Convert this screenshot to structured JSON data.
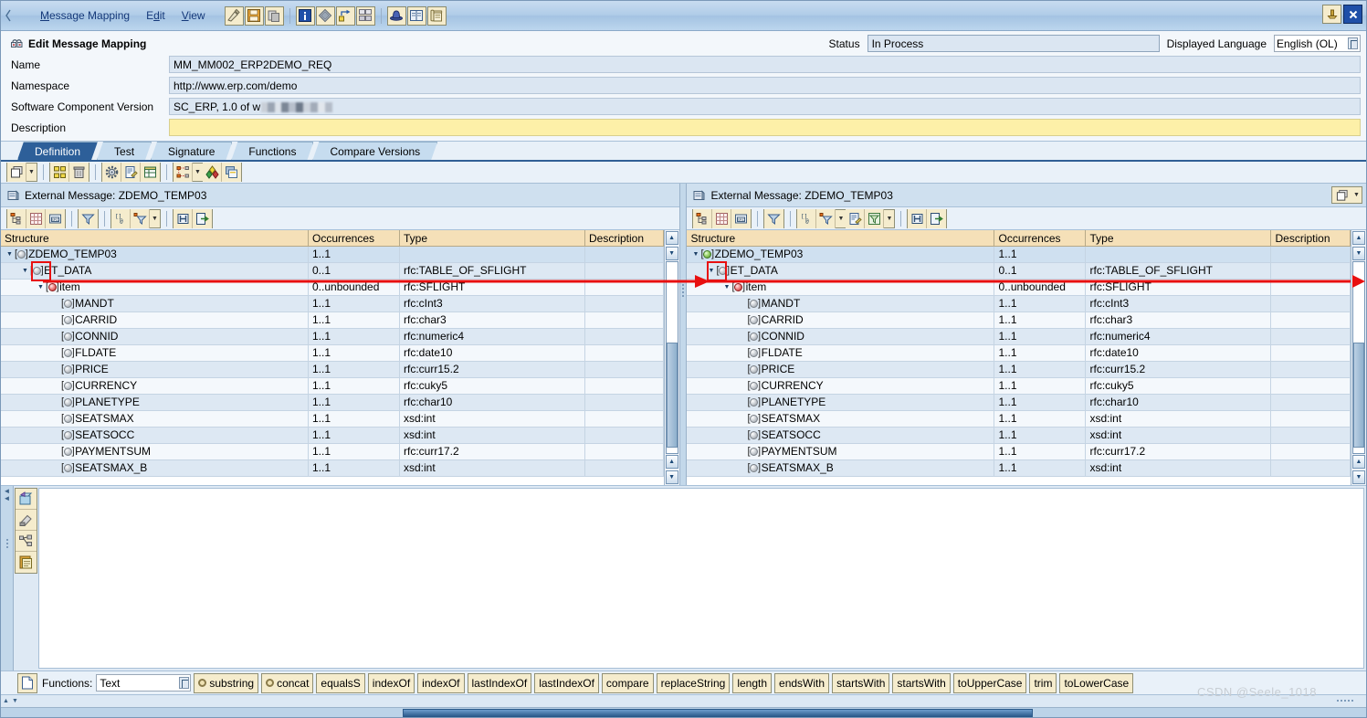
{
  "window": {
    "title": "Edit Message Mapping",
    "watermark": "CSDN @Seele_1018"
  },
  "menubar": {
    "items": [
      {
        "label": "Message Mapping",
        "accel": "M"
      },
      {
        "label": "Edit",
        "accel": "d"
      },
      {
        "label": "View",
        "accel": "V"
      }
    ],
    "tools": [
      {
        "name": "check-object-icon",
        "glyph": "✎"
      },
      {
        "name": "save-icon",
        "glyph": "💾"
      },
      {
        "name": "copy-object-icon",
        "glyph": "❐"
      },
      {
        "name": "info-icon",
        "glyph": "i"
      },
      {
        "name": "history-icon",
        "glyph": "◆"
      },
      {
        "name": "where-used-icon",
        "glyph": "⇆"
      },
      {
        "name": "dependencies-icon",
        "glyph": "⌗"
      },
      {
        "name": "release-icon",
        "glyph": "⛉"
      },
      {
        "name": "documentation-icon",
        "glyph": "📖"
      },
      {
        "name": "display-source-icon",
        "glyph": "📜"
      }
    ],
    "right_tools": [
      {
        "name": "pin-window-icon",
        "glyph": "⚓"
      },
      {
        "name": "close-window-icon",
        "glyph": "✖"
      }
    ]
  },
  "header": {
    "fields": [
      {
        "label": "Name",
        "value": "MM_MM002_ERP2DEMO_REQ",
        "style": "normal"
      },
      {
        "label": "Namespace",
        "value": "http://www.erp.com/demo",
        "style": "normal"
      },
      {
        "label": "Software Component Version",
        "value": "SC_ERP, 1.0 of w",
        "style": "redacted"
      },
      {
        "label": "Description",
        "value": "",
        "style": "yellow"
      }
    ],
    "status_label": "Status",
    "status_value": "In Process",
    "language_label": "Displayed Language",
    "language_value": "English (OL)"
  },
  "tabs": [
    {
      "label": "Definition",
      "active": true
    },
    {
      "label": "Test",
      "active": false
    },
    {
      "label": "Signature",
      "active": false
    },
    {
      "label": "Functions",
      "active": false
    },
    {
      "label": "Compare Versions",
      "active": false
    }
  ],
  "main_toolbar": {
    "groups": [
      {
        "buttons": [
          {
            "name": "new-window-icon",
            "glyph": "❐",
            "dropdown": true
          }
        ]
      },
      {
        "buttons": [
          {
            "name": "arrange-objects-icon",
            "glyph": "░"
          },
          {
            "name": "delete-icon",
            "glyph": "🗑"
          }
        ]
      },
      {
        "buttons": [
          {
            "name": "settings-gear-icon",
            "glyph": "⚙"
          },
          {
            "name": "edit-document-icon",
            "glyph": "📝"
          },
          {
            "name": "layout-grid-icon",
            "glyph": "▤"
          }
        ]
      },
      {
        "buttons": [
          {
            "name": "dependency-view-icon",
            "glyph": "☷",
            "dropdown": true
          },
          {
            "name": "color-palette-icon",
            "glyph": "❖"
          },
          {
            "name": "duplicate-view-icon",
            "glyph": "⧉"
          }
        ]
      }
    ]
  },
  "panels": {
    "left": {
      "title": "External Message: ZDEMO_TEMP03",
      "toolbar": [
        {
          "name": "expand-tree-icon",
          "glyph": "☰"
        },
        {
          "name": "grid-view-icon",
          "glyph": "▦"
        },
        {
          "name": "show-source-icon",
          "glyph": "SRC"
        },
        {
          "name": "filter-icon",
          "glyph": "▽"
        },
        {
          "name": "show-namespaces-icon",
          "glyph": "[]@"
        },
        {
          "name": "context-filter-icon",
          "glyph": "∇",
          "dropdown": true
        },
        {
          "name": "find-icon",
          "glyph": "🔍"
        },
        {
          "name": "export-icon",
          "glyph": "↪"
        }
      ],
      "columns": [
        "Structure",
        "Occurrences",
        "Type",
        "Description"
      ],
      "rows": [
        {
          "label": "ZDEMO_TEMP03",
          "occ": "1..1",
          "type": "",
          "desc": "",
          "depth": 0,
          "twisty": "open",
          "icon": "grey-ball",
          "selected": true,
          "highlight": true
        },
        {
          "label": "ET_DATA",
          "occ": "0..1",
          "type": "rfc:TABLE_OF_SFLIGHT",
          "desc": "",
          "depth": 1,
          "twisty": "open",
          "icon": "grey-ball"
        },
        {
          "label": "item",
          "occ": "0..unbounded",
          "type": "rfc:SFLIGHT",
          "desc": "",
          "depth": 2,
          "twisty": "open",
          "icon": "red-ball"
        },
        {
          "label": "MANDT",
          "occ": "1..1",
          "type": "rfc:cInt3",
          "desc": "",
          "depth": 3,
          "twisty": "none",
          "icon": "grey-ball"
        },
        {
          "label": "CARRID",
          "occ": "1..1",
          "type": "rfc:char3",
          "desc": "",
          "depth": 3,
          "twisty": "none",
          "icon": "grey-ball"
        },
        {
          "label": "CONNID",
          "occ": "1..1",
          "type": "rfc:numeric4",
          "desc": "",
          "depth": 3,
          "twisty": "none",
          "icon": "grey-ball"
        },
        {
          "label": "FLDATE",
          "occ": "1..1",
          "type": "rfc:date10",
          "desc": "",
          "depth": 3,
          "twisty": "none",
          "icon": "grey-ball"
        },
        {
          "label": "PRICE",
          "occ": "1..1",
          "type": "rfc:curr15.2",
          "desc": "",
          "depth": 3,
          "twisty": "none",
          "icon": "grey-ball"
        },
        {
          "label": "CURRENCY",
          "occ": "1..1",
          "type": "rfc:cuky5",
          "desc": "",
          "depth": 3,
          "twisty": "none",
          "icon": "grey-ball"
        },
        {
          "label": "PLANETYPE",
          "occ": "1..1",
          "type": "rfc:char10",
          "desc": "",
          "depth": 3,
          "twisty": "none",
          "icon": "grey-ball"
        },
        {
          "label": "SEATSMAX",
          "occ": "1..1",
          "type": "xsd:int",
          "desc": "",
          "depth": 3,
          "twisty": "none",
          "icon": "grey-ball"
        },
        {
          "label": "SEATSOCC",
          "occ": "1..1",
          "type": "xsd:int",
          "desc": "",
          "depth": 3,
          "twisty": "none",
          "icon": "grey-ball"
        },
        {
          "label": "PAYMENTSUM",
          "occ": "1..1",
          "type": "rfc:curr17.2",
          "desc": "",
          "depth": 3,
          "twisty": "none",
          "icon": "grey-ball"
        },
        {
          "label": "SEATSMAX_B",
          "occ": "1..1",
          "type": "xsd:int",
          "desc": "",
          "depth": 3,
          "twisty": "none",
          "icon": "grey-ball"
        }
      ]
    },
    "right": {
      "title": "External Message: ZDEMO_TEMP03",
      "toolbar": [
        {
          "name": "expand-tree-icon",
          "glyph": "☰"
        },
        {
          "name": "grid-view-icon",
          "glyph": "▦"
        },
        {
          "name": "show-source-icon",
          "glyph": "SRC"
        },
        {
          "name": "filter-icon",
          "glyph": "▽"
        },
        {
          "name": "show-namespaces-icon",
          "glyph": "[]@"
        },
        {
          "name": "context-filter-icon",
          "glyph": "∇",
          "dropdown": true
        },
        {
          "name": "edit-document-icon",
          "glyph": "📝"
        },
        {
          "name": "advanced-filter-icon",
          "glyph": "⌘",
          "dropdown": true
        },
        {
          "name": "find-icon",
          "glyph": "🔍"
        },
        {
          "name": "export-icon",
          "glyph": "↪"
        }
      ],
      "columns": [
        "Structure",
        "Occurrences",
        "Type",
        "Description"
      ],
      "rows": [
        {
          "label": "ZDEMO_TEMP03",
          "occ": "1..1",
          "type": "",
          "desc": "",
          "depth": 0,
          "twisty": "open",
          "icon": "green-ball",
          "selected": true,
          "highlight": true
        },
        {
          "label": "ET_DATA",
          "occ": "0..1",
          "type": "rfc:TABLE_OF_SFLIGHT",
          "desc": "",
          "depth": 1,
          "twisty": "open",
          "icon": "grey-ball"
        },
        {
          "label": "item",
          "occ": "0..unbounded",
          "type": "rfc:SFLIGHT",
          "desc": "",
          "depth": 2,
          "twisty": "open",
          "icon": "red-ball"
        },
        {
          "label": "MANDT",
          "occ": "1..1",
          "type": "rfc:cInt3",
          "desc": "",
          "depth": 3,
          "twisty": "none",
          "icon": "grey-ball"
        },
        {
          "label": "CARRID",
          "occ": "1..1",
          "type": "rfc:char3",
          "desc": "",
          "depth": 3,
          "twisty": "none",
          "icon": "grey-ball"
        },
        {
          "label": "CONNID",
          "occ": "1..1",
          "type": "rfc:numeric4",
          "desc": "",
          "depth": 3,
          "twisty": "none",
          "icon": "grey-ball"
        },
        {
          "label": "FLDATE",
          "occ": "1..1",
          "type": "rfc:date10",
          "desc": "",
          "depth": 3,
          "twisty": "none",
          "icon": "grey-ball"
        },
        {
          "label": "PRICE",
          "occ": "1..1",
          "type": "rfc:curr15.2",
          "desc": "",
          "depth": 3,
          "twisty": "none",
          "icon": "grey-ball"
        },
        {
          "label": "CURRENCY",
          "occ": "1..1",
          "type": "rfc:cuky5",
          "desc": "",
          "depth": 3,
          "twisty": "none",
          "icon": "grey-ball"
        },
        {
          "label": "PLANETYPE",
          "occ": "1..1",
          "type": "rfc:char10",
          "desc": "",
          "depth": 3,
          "twisty": "none",
          "icon": "grey-ball"
        },
        {
          "label": "SEATSMAX",
          "occ": "1..1",
          "type": "xsd:int",
          "desc": "",
          "depth": 3,
          "twisty": "none",
          "icon": "grey-ball"
        },
        {
          "label": "SEATSOCC",
          "occ": "1..1",
          "type": "xsd:int",
          "desc": "",
          "depth": 3,
          "twisty": "none",
          "icon": "grey-ball"
        },
        {
          "label": "PAYMENTSUM",
          "occ": "1..1",
          "type": "rfc:curr17.2",
          "desc": "",
          "depth": 3,
          "twisty": "none",
          "icon": "grey-ball"
        },
        {
          "label": "SEATSMAX_B",
          "occ": "1..1",
          "type": "xsd:int",
          "desc": "",
          "depth": 3,
          "twisty": "none",
          "icon": "grey-ball"
        }
      ]
    }
  },
  "mapping_editor": {
    "vertical_tools": [
      {
        "name": "create-mapping-icon",
        "glyph": "❐"
      },
      {
        "name": "clear-mapping-icon",
        "glyph": "▱"
      },
      {
        "name": "dependency-icon",
        "glyph": "☷"
      },
      {
        "name": "paste-icon",
        "glyph": "📋"
      }
    ]
  },
  "function_bar": {
    "doc_icon": "document-icon",
    "label": "Functions:",
    "category": "Text",
    "buttons": [
      {
        "label": "substring",
        "gear": true
      },
      {
        "label": "concat",
        "gear": true
      },
      {
        "label": "equalsS",
        "gear": false
      },
      {
        "label": "indexOf",
        "gear": false
      },
      {
        "label": "indexOf",
        "gear": false
      },
      {
        "label": "lastIndexOf",
        "gear": false
      },
      {
        "label": "lastIndexOf",
        "gear": false
      },
      {
        "label": "compare",
        "gear": false
      },
      {
        "label": "replaceString",
        "gear": false
      },
      {
        "label": "length",
        "gear": false
      },
      {
        "label": "endsWith",
        "gear": false
      },
      {
        "label": "startsWith",
        "gear": false
      },
      {
        "label": "startsWith",
        "gear": false
      },
      {
        "label": "toUpperCase",
        "gear": false
      },
      {
        "label": "trim",
        "gear": false
      },
      {
        "label": "toLowerCase",
        "gear": false
      }
    ]
  },
  "colors": {
    "accent": "#2d5f99",
    "header_col": "#f5e0b8",
    "field_bg": "#dbe6f2",
    "yellow_field": "#fdf0a8",
    "highlight": "#e81010",
    "arrow": "#e81010"
  }
}
